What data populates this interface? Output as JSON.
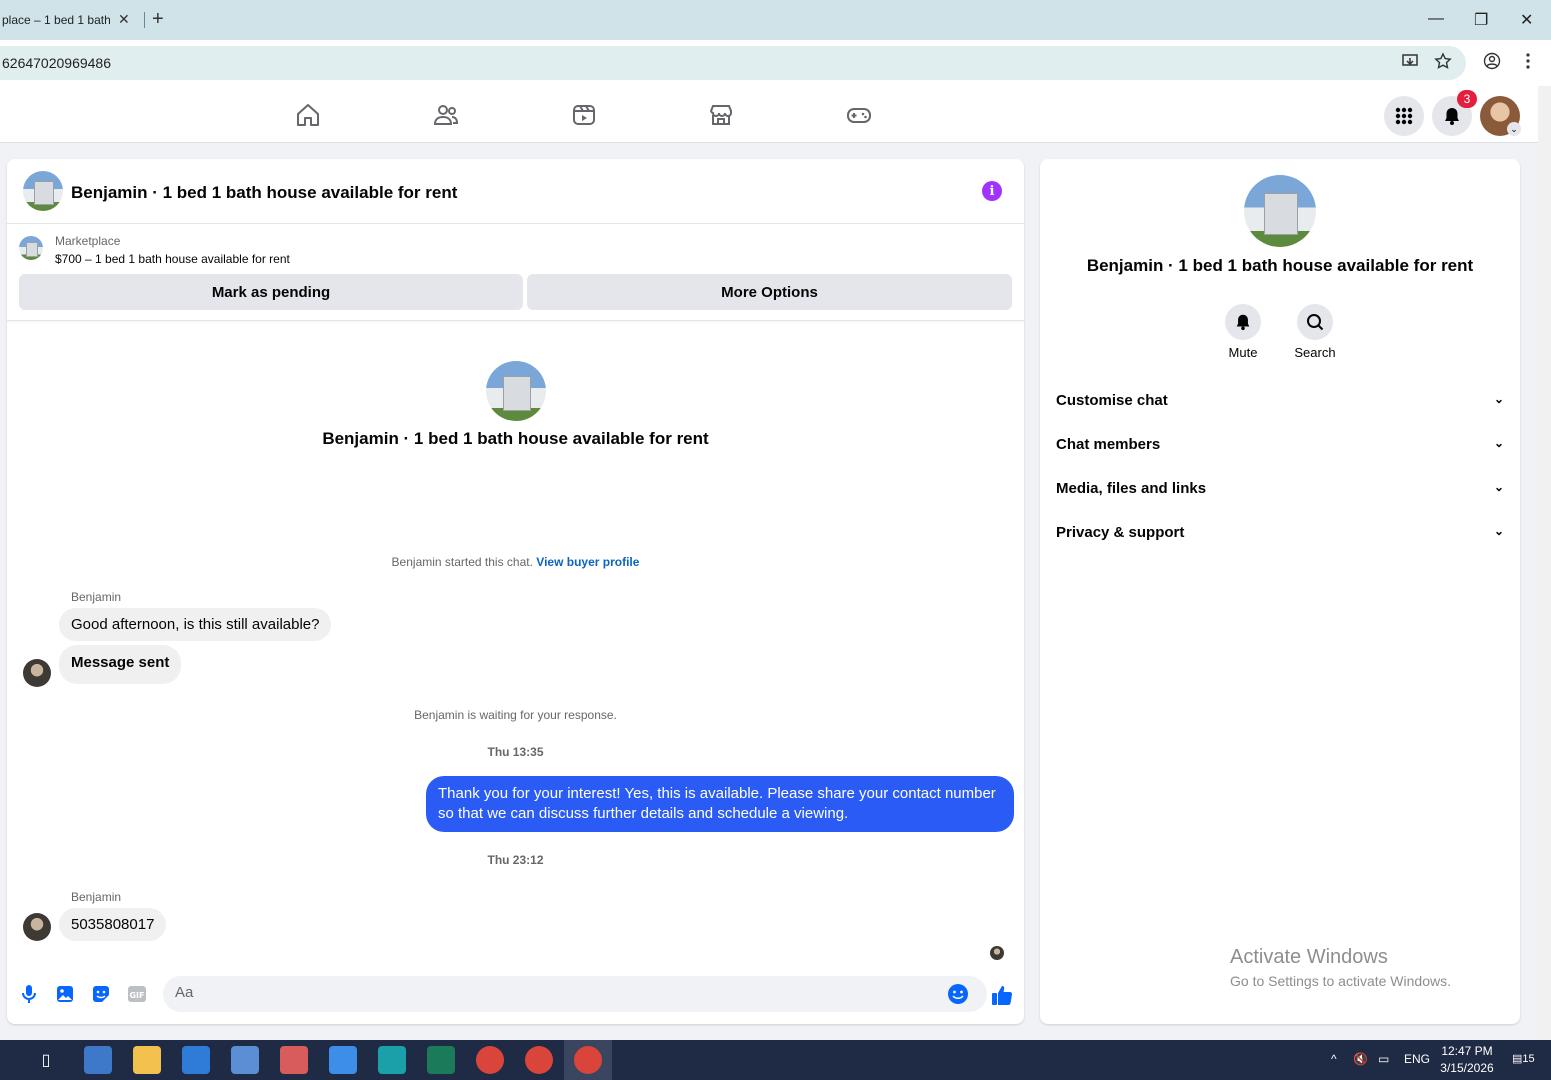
{
  "browser": {
    "tab_title": "place – 1 bed 1 bath",
    "tab_close": "✕",
    "new_tab": "+",
    "url": "62647020969486",
    "win_min": "—",
    "win_max": "❐",
    "win_close": "✕"
  },
  "nav": {
    "notif_count": "3",
    "icons": [
      "home-icon",
      "friends-icon",
      "video-icon",
      "marketplace-icon",
      "gaming-icon"
    ]
  },
  "chat": {
    "title": "Benjamin · 1 bed 1 bath house available for rent",
    "marketplace_label": "Marketplace",
    "listing": "$700 – 1 bed 1 bath house available for rent",
    "mark_pending": "Mark as pending",
    "more_options": "More Options",
    "center_title": "Benjamin · 1 bed 1 bath house available for rent",
    "started_text": "Benjamin started this chat. ",
    "view_buyer": "View buyer profile",
    "messages": [
      {
        "sender": "Benjamin",
        "text": "Good afternoon, is this still available?"
      },
      {
        "text": "Message sent"
      },
      {
        "system": "Benjamin is waiting for your response."
      },
      {
        "time": "Thu 13:35"
      },
      {
        "outgoing": "Thank you for your interest! Yes, this is available. Please share your contact number so that we can discuss further details and schedule a viewing."
      },
      {
        "time": "Thu 23:12"
      },
      {
        "sender": "Benjamin",
        "text": "5035808017"
      }
    ],
    "composer_placeholder": "Aa"
  },
  "info_panel": {
    "title": "Benjamin · 1 bed 1 bath house available for rent",
    "mute": "Mute",
    "search": "Search",
    "sections": [
      "Customise chat",
      "Chat members",
      "Media, files and links",
      "Privacy & support"
    ]
  },
  "watermark": {
    "line1": "Activate Windows",
    "line2": "Go to Settings to activate Windows."
  },
  "taskbar": {
    "lang": "ENG",
    "time": "12:47 PM",
    "date": "3/15/2026",
    "notif_count": "15"
  },
  "colors": {
    "accent": "#2a5bf5",
    "info": "#a033ff",
    "badge": "#e41e3f"
  }
}
